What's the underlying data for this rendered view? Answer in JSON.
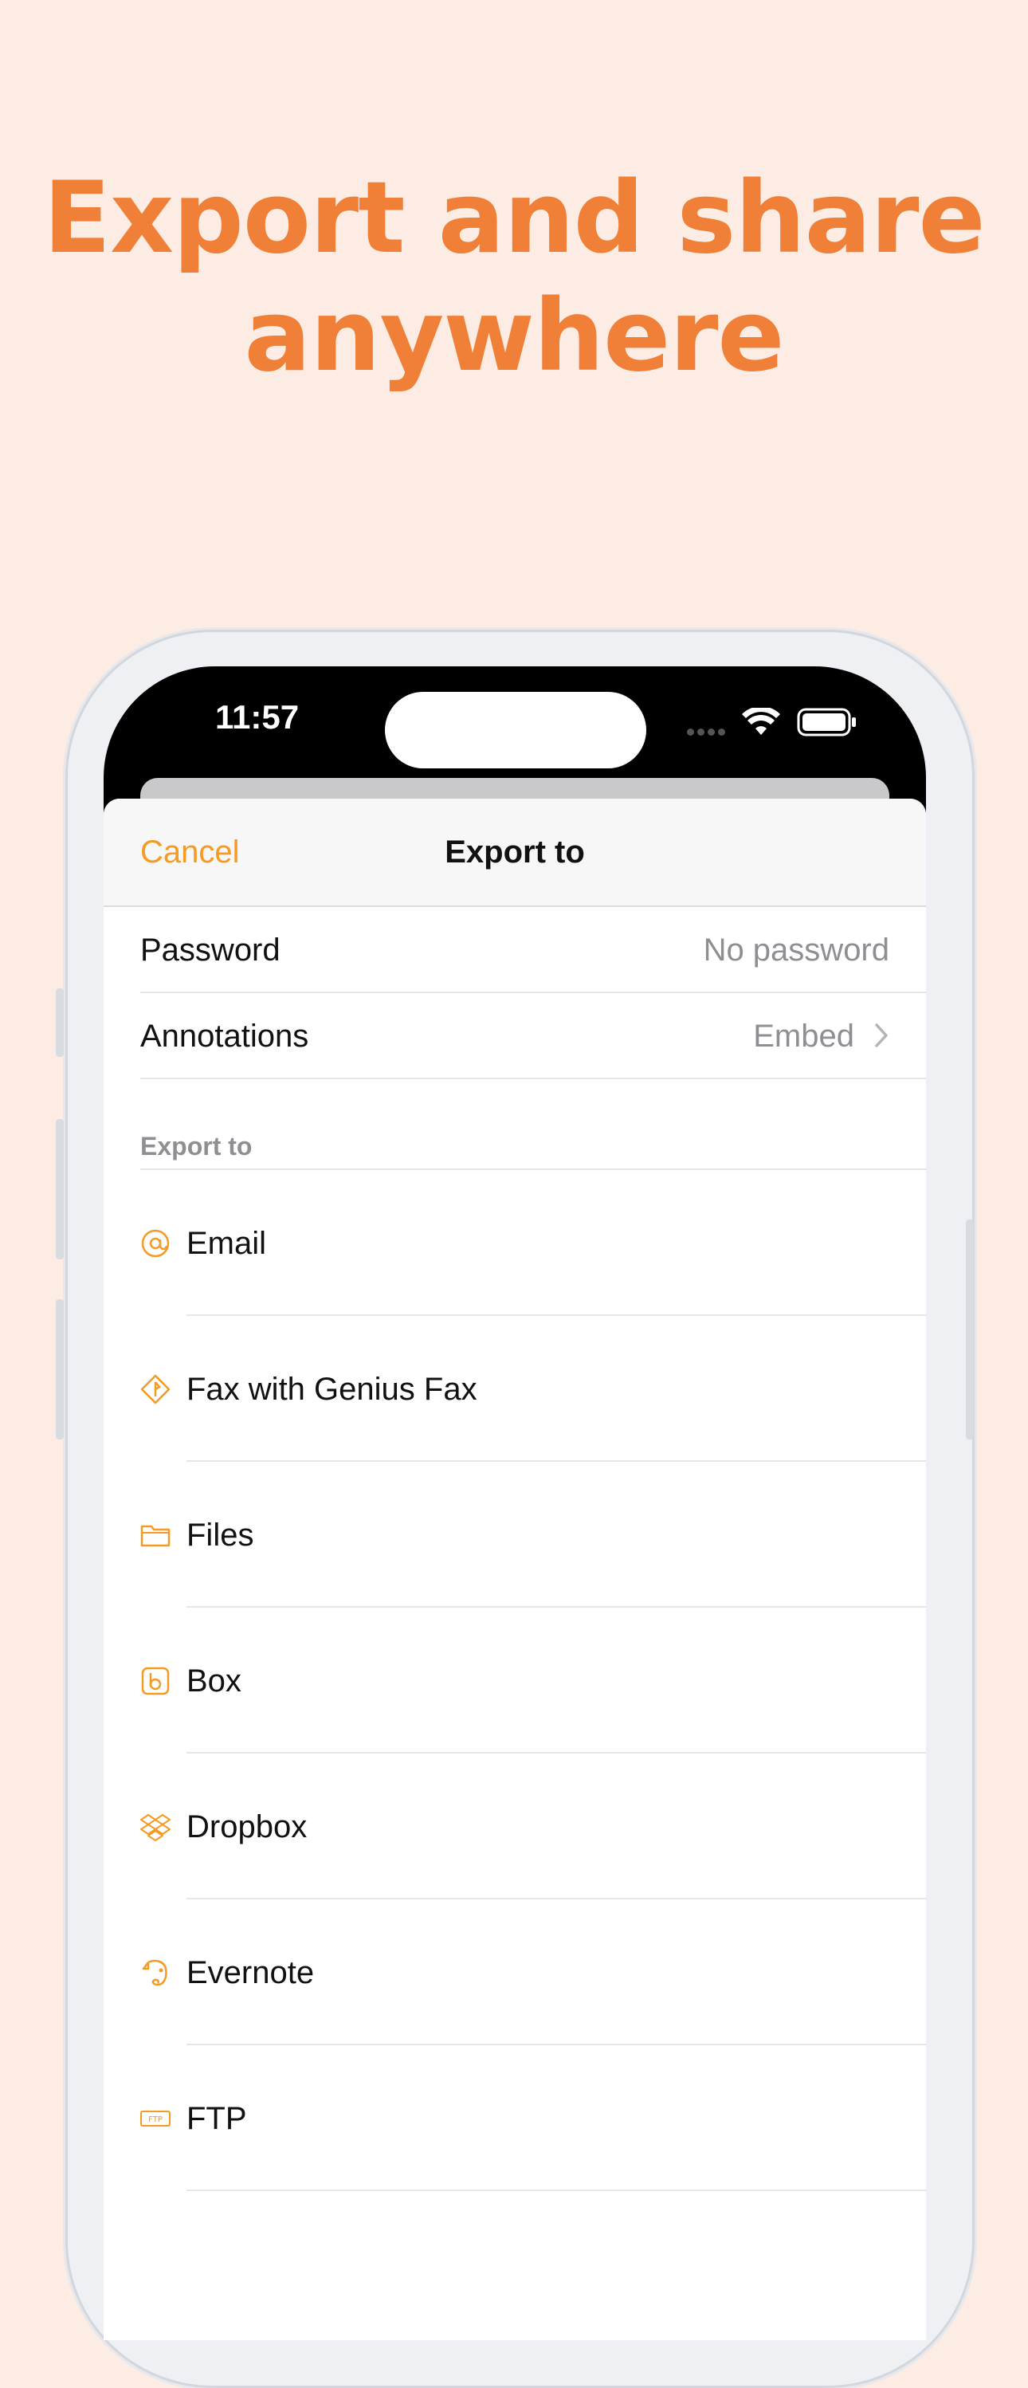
{
  "headline": {
    "line1": "Export and share",
    "line2": "anywhere"
  },
  "status_bar": {
    "time": "11:57"
  },
  "nav": {
    "cancel_label": "Cancel",
    "title": "Export to"
  },
  "settings": {
    "password": {
      "label": "Password",
      "value": "No password"
    },
    "annotations": {
      "label": "Annotations",
      "value": "Embed"
    }
  },
  "section_header": "Export to",
  "destinations": [
    {
      "label": "Email",
      "icon": "at-icon"
    },
    {
      "label": "Fax with Genius Fax",
      "icon": "genius-fax-icon"
    },
    {
      "label": "Files",
      "icon": "folder-icon"
    },
    {
      "label": "Box",
      "icon": "box-icon"
    },
    {
      "label": "Dropbox",
      "icon": "dropbox-icon"
    },
    {
      "label": "Evernote",
      "icon": "evernote-icon"
    },
    {
      "label": "FTP",
      "icon": "ftp-icon"
    }
  ],
  "colors": {
    "accent": "#f59a23",
    "headline": "#f07f38",
    "background": "#fdece3"
  }
}
